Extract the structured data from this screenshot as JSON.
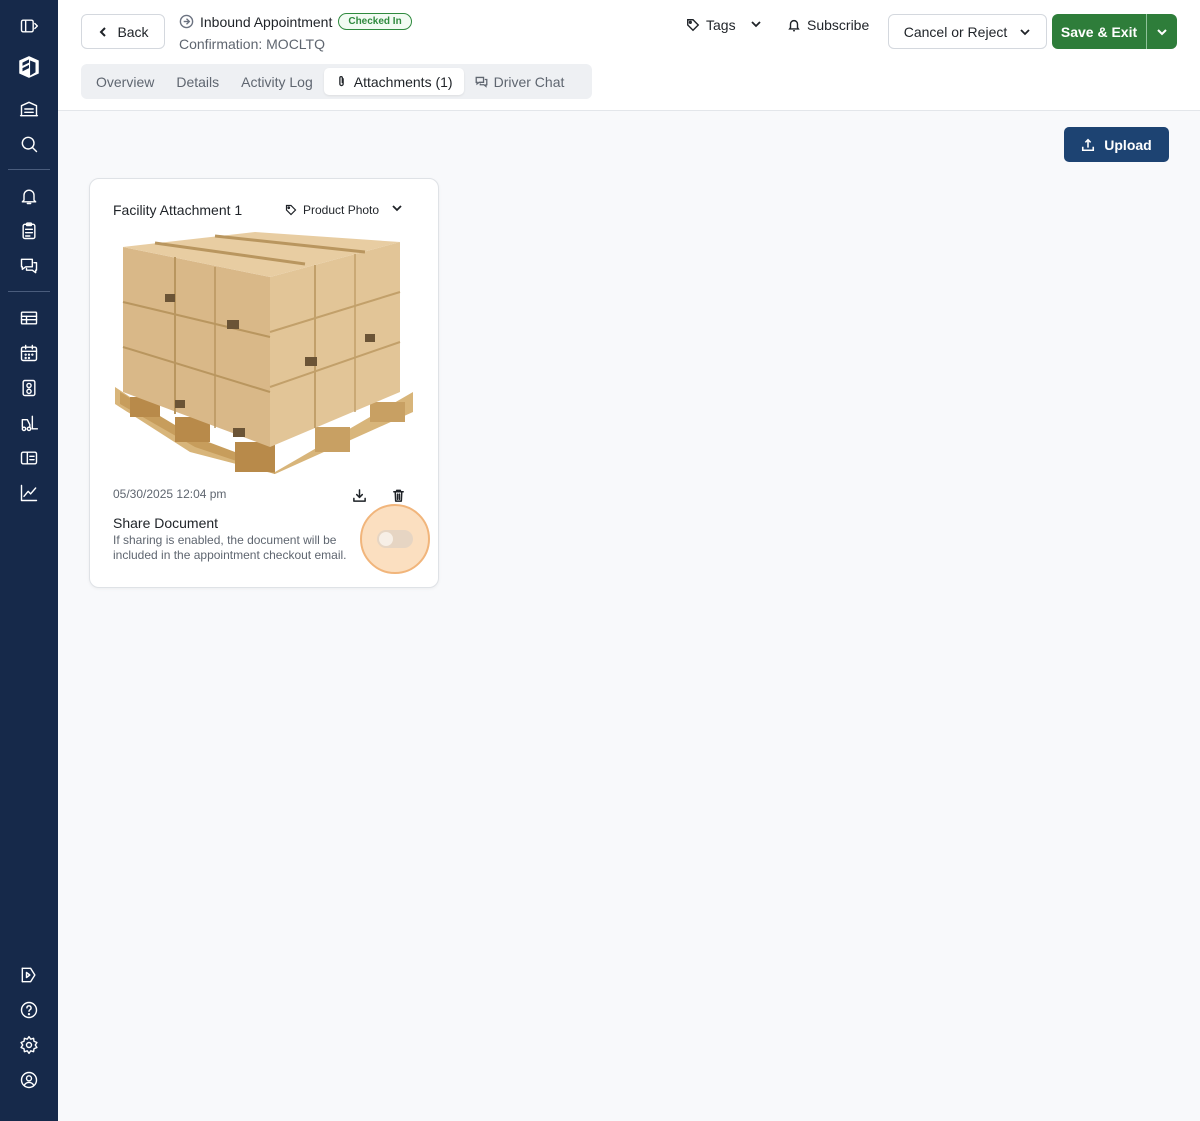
{
  "sidebar": {
    "items": [
      {
        "icon": "panel-toggle-icon"
      },
      {
        "icon": "brand-logo-icon"
      },
      {
        "icon": "warehouse-icon"
      },
      {
        "icon": "search-icon"
      },
      {
        "icon": "bell-icon"
      },
      {
        "icon": "clipboard-icon"
      },
      {
        "icon": "chat-icon"
      },
      {
        "icon": "list-icon"
      },
      {
        "icon": "calendar-icon"
      },
      {
        "icon": "dock-icon"
      },
      {
        "icon": "forklift-icon"
      },
      {
        "icon": "id-card-icon"
      },
      {
        "icon": "chart-icon"
      }
    ],
    "bottom_items": [
      {
        "icon": "tour-icon"
      },
      {
        "icon": "help-icon"
      },
      {
        "icon": "settings-icon"
      },
      {
        "icon": "profile-icon"
      }
    ]
  },
  "header": {
    "back_label": "Back",
    "appointment_type": "Inbound Appointment",
    "status": "Checked In",
    "confirmation": "Confirmation: MOCLTQ",
    "tags_label": "Tags",
    "subscribe_label": "Subscribe",
    "cancel_label": "Cancel or Reject",
    "save_label": "Save & Exit",
    "status_color": "#2f8a3e",
    "save_color": "#2e7d3a"
  },
  "tabs": [
    {
      "label": "Overview",
      "active": false
    },
    {
      "label": "Details",
      "active": false
    },
    {
      "label": "Activity Log",
      "active": false
    },
    {
      "label": "Attachments (1)",
      "active": true
    },
    {
      "label": "Driver Chat",
      "active": false
    }
  ],
  "upload_label": "Upload",
  "upload_color": "#1d4372",
  "attachment": {
    "title": "Facility Attachment 1",
    "tag": "Product Photo",
    "date": "05/30/2025 12:04 pm",
    "share_title": "Share Document",
    "share_description": "If sharing is enabled, the document will be included in the appointment checkout email.",
    "share_enabled": false
  }
}
